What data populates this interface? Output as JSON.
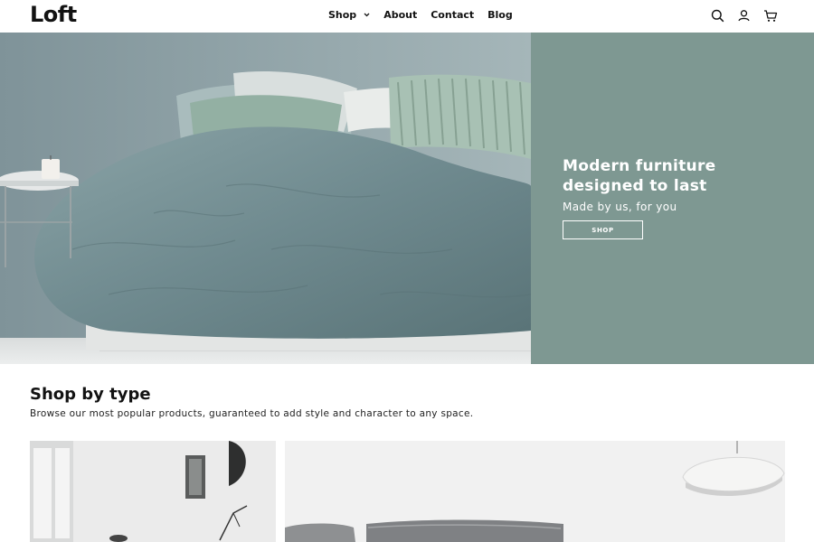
{
  "header": {
    "logo": "Loft",
    "nav": [
      {
        "label": "Shop",
        "has_dropdown": true
      },
      {
        "label": "About"
      },
      {
        "label": "Contact"
      },
      {
        "label": "Blog"
      }
    ],
    "icons": [
      "search-icon",
      "account-icon",
      "cart-icon"
    ]
  },
  "hero": {
    "title": "Modern furniture designed to last",
    "subtitle": "Made by us, for you",
    "button_label": "SHOP",
    "panel_color": "#7e9892"
  },
  "shop_by_type": {
    "title": "Shop by type",
    "description": "Browse our most popular products, guaranteed to add style and character to any space."
  }
}
